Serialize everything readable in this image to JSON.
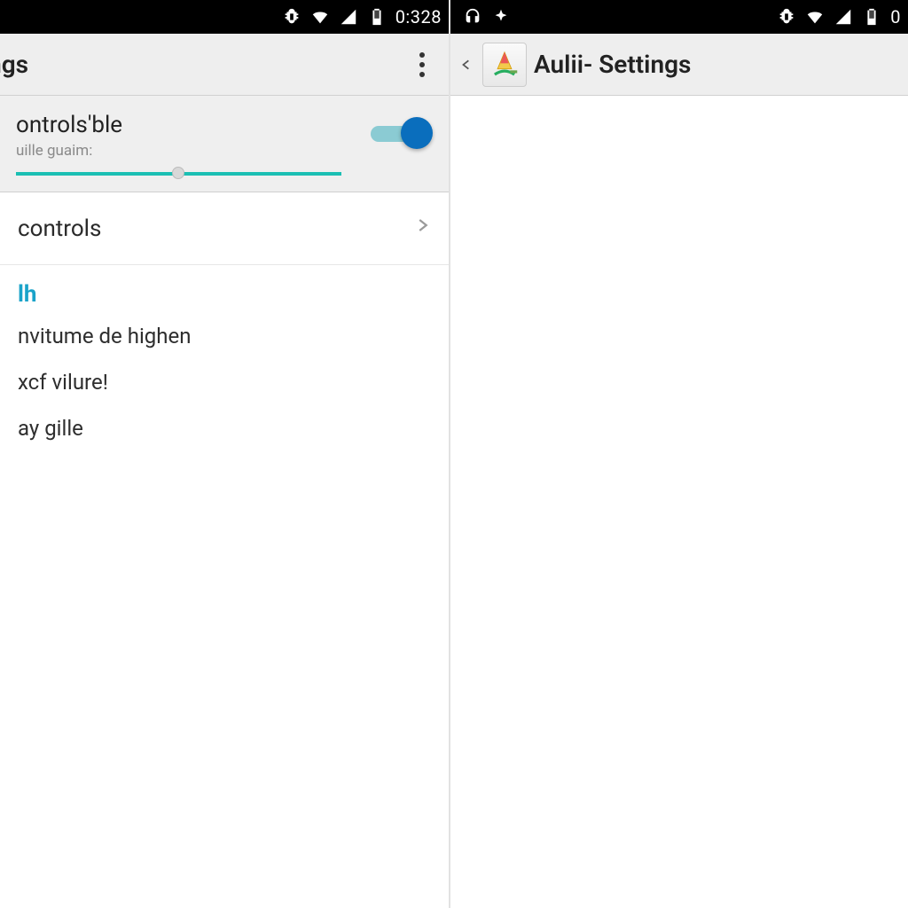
{
  "colors": {
    "accent": "#1bbfb3",
    "switch_thumb": "#0a6ebd",
    "section_header": "#1aa3c9"
  },
  "left": {
    "status": {
      "clock": "0:328"
    },
    "actionbar": {
      "title": "ttings"
    },
    "toggle_card": {
      "title": "ontrols'ble",
      "subtitle": "uille guaim:",
      "switch_on": true
    },
    "nav_row": {
      "label": "controls"
    },
    "section": {
      "header": "lh",
      "items": [
        "nvitume de highen",
        "xcf vilure!",
        "ay gille"
      ]
    }
  },
  "right": {
    "status": {
      "clock": "0"
    },
    "actionbar": {
      "title": "Aulii- Settings"
    }
  }
}
